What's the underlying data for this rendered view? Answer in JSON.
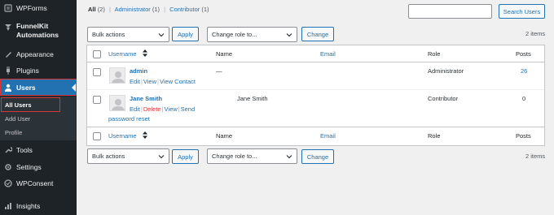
{
  "sidebar": {
    "items": [
      {
        "label": "WPForms",
        "icon": "wpforms-icon"
      },
      {
        "label": "FunnelKit",
        "label2": "Automations",
        "icon": "funnelkit-icon"
      },
      {
        "label": "Appearance",
        "icon": "appearance-icon"
      },
      {
        "label": "Plugins",
        "icon": "plugins-icon"
      },
      {
        "label": "Users",
        "icon": "users-icon"
      },
      {
        "label": "Tools",
        "icon": "tools-icon"
      },
      {
        "label": "Settings",
        "icon": "settings-icon"
      },
      {
        "label": "WPConsent",
        "icon": "wpconsent-icon"
      },
      {
        "label": "Insights",
        "icon": "insights-icon"
      }
    ],
    "submenu": [
      "All Users",
      "Add User",
      "Profile"
    ]
  },
  "filters": {
    "all": "All",
    "all_count": "(2)",
    "admin": "Administrator",
    "admin_count": "(1)",
    "contrib": "Contributor",
    "contrib_count": "(1)",
    "separator": "|"
  },
  "search": {
    "button": "Search Users",
    "value": ""
  },
  "bulk": {
    "bulk_actions": "Bulk actions",
    "apply": "Apply",
    "change_role": "Change role to...",
    "change": "Change",
    "items_count": "2 items"
  },
  "table": {
    "columns": [
      "Username",
      "Name",
      "Email",
      "Role",
      "Posts"
    ],
    "rows": [
      {
        "username": "admin",
        "name": "—",
        "email": "",
        "role": "Administrator",
        "posts": "26",
        "actions": [
          "Edit",
          "View",
          "View Contact"
        ]
      },
      {
        "username": "Jane Smith",
        "name": "Jane Smith",
        "email": "",
        "role": "Contributor",
        "posts": "0",
        "actions": [
          "Edit",
          "Delete",
          "View",
          "Send"
        ],
        "actions_line2": "password reset"
      }
    ]
  },
  "colors": {
    "sidebar_bg": "#1d2327",
    "active_bg": "#2271b1",
    "link": "#2271b1",
    "highlight": "#d63638"
  }
}
